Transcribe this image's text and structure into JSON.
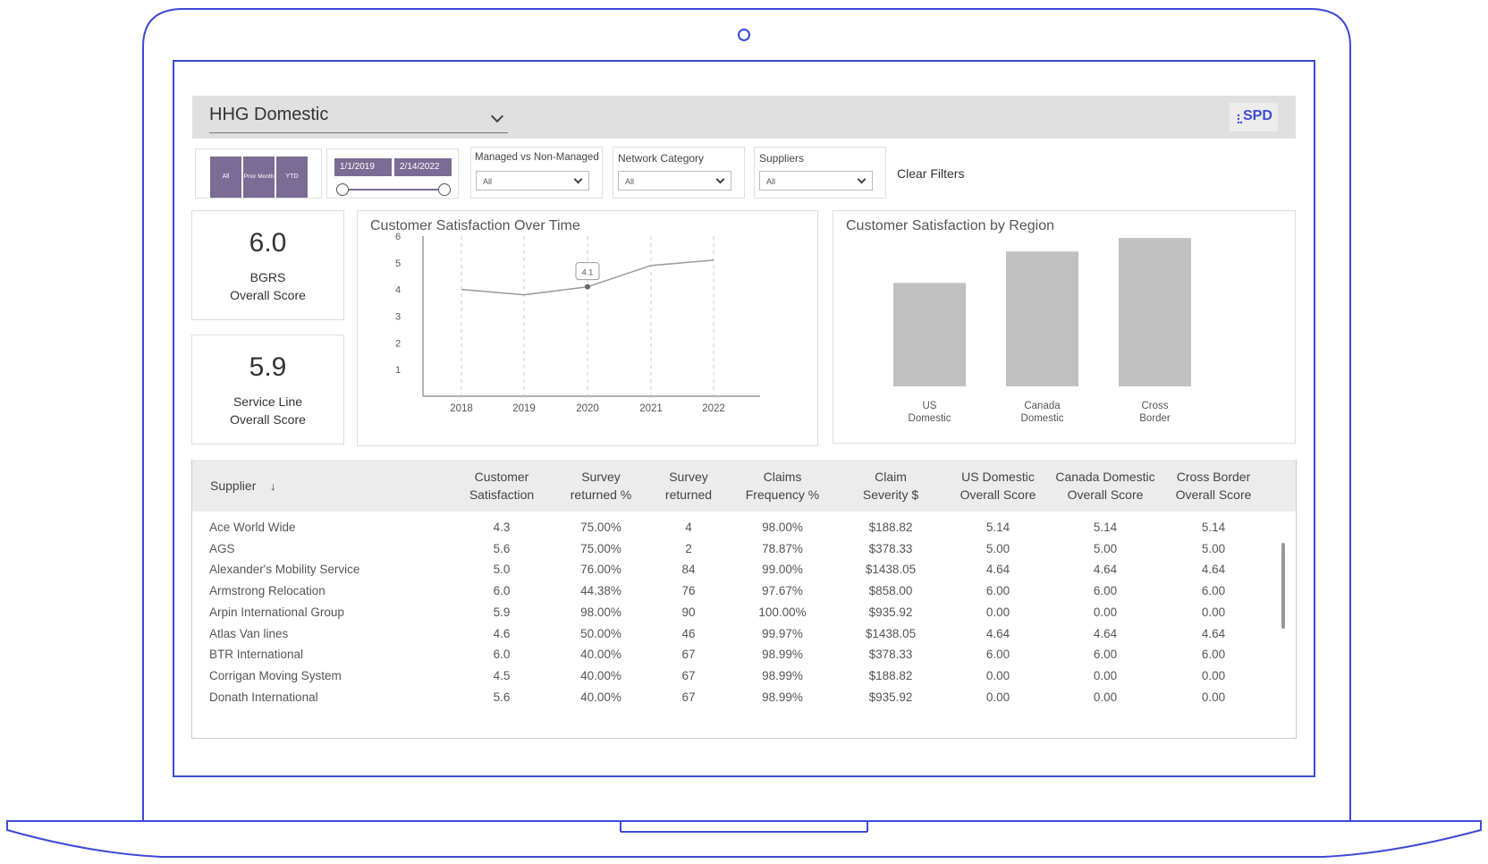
{
  "header": {
    "title": "HHG Domestic",
    "logo_text": "SPD"
  },
  "filters": {
    "period_buttons": [
      "All",
      "Prior Month",
      "YTD"
    ],
    "date_start": "1/1/2019",
    "date_end": "2/14/2022",
    "managed": {
      "label": "Managed vs Non-Managed",
      "value": "All"
    },
    "network": {
      "label": "Network Category",
      "value": "All"
    },
    "suppliers": {
      "label": "Suppliers",
      "value": "All"
    },
    "clear_label": "Clear Filters"
  },
  "kpis": [
    {
      "value": "6.0",
      "label_line1": "BGRS",
      "label_line2": "Overall Score"
    },
    {
      "value": "5.9",
      "label_line1": "Service Line",
      "label_line2": "Overall Score"
    }
  ],
  "line_chart": {
    "title": "Customer Satisfaction Over Time",
    "point_label": "4.1"
  },
  "bar_chart": {
    "title": "Customer Satisfaction by Region"
  },
  "chart_data": [
    {
      "type": "line",
      "title": "Customer Satisfaction Over Time",
      "x": [
        "2018",
        "2019",
        "2020",
        "2021",
        "2022"
      ],
      "y_ticks": [
        "1",
        "2",
        "3",
        "4",
        "5",
        "6"
      ],
      "series": [
        {
          "values": [
            4.0,
            3.8,
            4.1,
            4.9,
            5.1
          ]
        }
      ],
      "ylim": [
        0,
        6
      ],
      "annotation": {
        "x": "2020",
        "label": "4.1"
      },
      "grid": "vertical dashed"
    },
    {
      "type": "bar",
      "title": "Customer Satisfaction by Region",
      "categories": [
        "US Domestic",
        "Canada Domestic",
        "Cross Border"
      ],
      "category_lines": [
        [
          "US",
          "Domestic"
        ],
        [
          "Canada",
          "Domestic"
        ],
        [
          "Cross",
          "Border"
        ]
      ],
      "values": [
        4.6,
        6.0,
        6.6
      ],
      "ylim": [
        0,
        7.0
      ]
    }
  ],
  "table": {
    "sort_column": "Supplier",
    "columns": [
      {
        "line1": "Supplier",
        "line2": ""
      },
      {
        "line1": "Customer",
        "line2": "Satisfaction"
      },
      {
        "line1": "Survey",
        "line2": "returned %"
      },
      {
        "line1": "Survey",
        "line2": "returned"
      },
      {
        "line1": "Claims",
        "line2": "Frequency %"
      },
      {
        "line1": "Claim",
        "line2": "Severity $"
      },
      {
        "line1": "US Domestic",
        "line2": "Overall Score"
      },
      {
        "line1": "Canada Domestic",
        "line2": "Overall Score"
      },
      {
        "line1": "Cross Border",
        "line2": "Overall Score"
      }
    ],
    "rows": [
      [
        "Ace World Wide",
        "4.3",
        "75.00%",
        "4",
        "98.00%",
        "$188.82",
        "5.14",
        "5.14",
        "5.14"
      ],
      [
        "AGS",
        "5.6",
        "75.00%",
        "2",
        "78.87%",
        "$378.33",
        "5.00",
        "5.00",
        "5.00"
      ],
      [
        "Alexander's Mobility Service",
        "5.0",
        "76.00%",
        "84",
        "99.00%",
        "$1438.05",
        "4.64",
        "4.64",
        "4.64"
      ],
      [
        "Armstrong Relocation",
        "6.0",
        "44.38%",
        "76",
        "97.67%",
        "$858.00",
        "6.00",
        "6.00",
        "6.00"
      ],
      [
        "Arpin International Group",
        "5.9",
        "98.00%",
        "90",
        "100.00%",
        "$935.92",
        "0.00",
        "0.00",
        "0.00"
      ],
      [
        "Atlas Van lines",
        "4.6",
        "50.00%",
        "46",
        "99.97%",
        "$1438.05",
        "4.64",
        "4.64",
        "4.64"
      ],
      [
        "BTR International",
        "6.0",
        "40.00%",
        "67",
        "98.99%",
        "$378.33",
        "6.00",
        "6.00",
        "6.00"
      ],
      [
        "Corrigan Moving System",
        "4.5",
        "40.00%",
        "67",
        "98.99%",
        "$188.82",
        "0.00",
        "0.00",
        "0.00"
      ],
      [
        "Donath International",
        "5.6",
        "40.00%",
        "67",
        "98.99%",
        "$935.92",
        "0.00",
        "0.00",
        "0.00"
      ]
    ]
  },
  "colors": {
    "accent": "#7b6c95",
    "device_outline": "#3d49d6",
    "bar": "#c0c0c0",
    "header_bg": "#e0e0e0"
  }
}
